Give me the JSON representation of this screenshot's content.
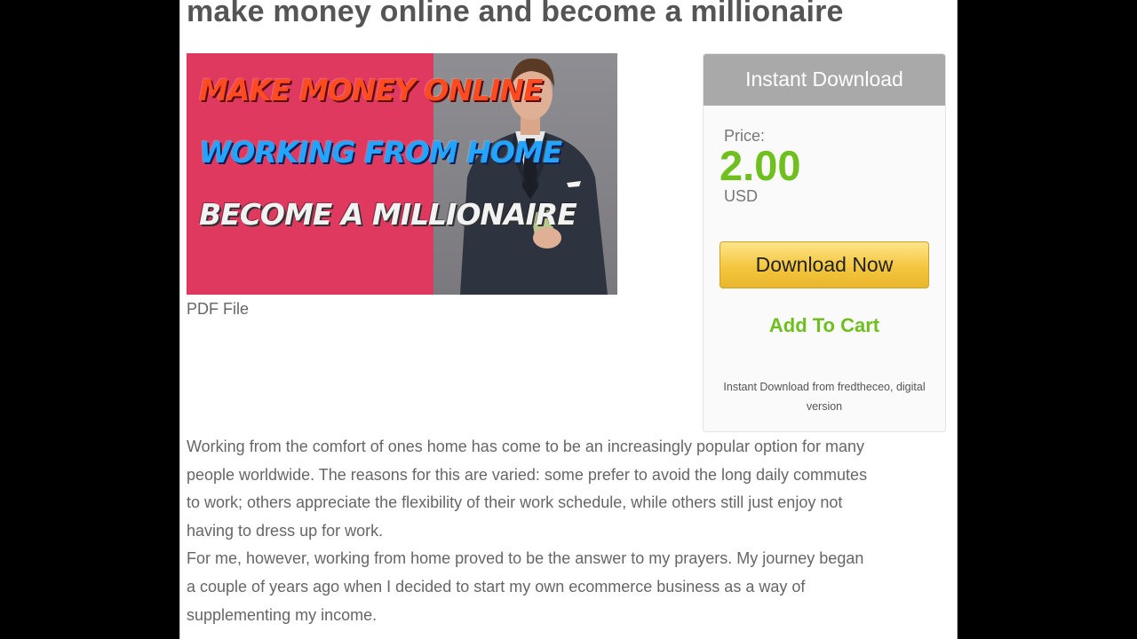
{
  "product": {
    "title": "make money online and become a millionaire",
    "image": {
      "line1": "MAKE MONEY ONLINE",
      "line2": "WORKING FROM HOME",
      "line3": "BECOME A MILLIONAIRE"
    },
    "file_type": "PDF File"
  },
  "sidebar": {
    "header": "Instant Download",
    "price_label": "Price:",
    "price_value": "2.00",
    "currency": "USD",
    "download_button": "Download Now",
    "add_to_cart": "Add To Cart",
    "seller_note": "Instant Download from fredtheceo, digital version"
  },
  "description": {
    "paragraph1": "Working from the comfort of ones home has come to be an increasingly popular option for many people worldwide. The reasons for this are varied: some prefer to avoid the long daily commutes to work; others appreciate the flexibility of their work schedule, while others still just enjoy not having to dress up for work.",
    "paragraph2": "For me, however, working from home proved to be the answer to my prayers. My journey began a couple of years ago when I decided to start my own ecommerce business as a way of supplementing my income."
  },
  "colors": {
    "accent_green": "#6fbf1f",
    "button_gold": "#f3c63f",
    "header_gray": "#a9a9a9",
    "image_pink": "#e0395f"
  }
}
